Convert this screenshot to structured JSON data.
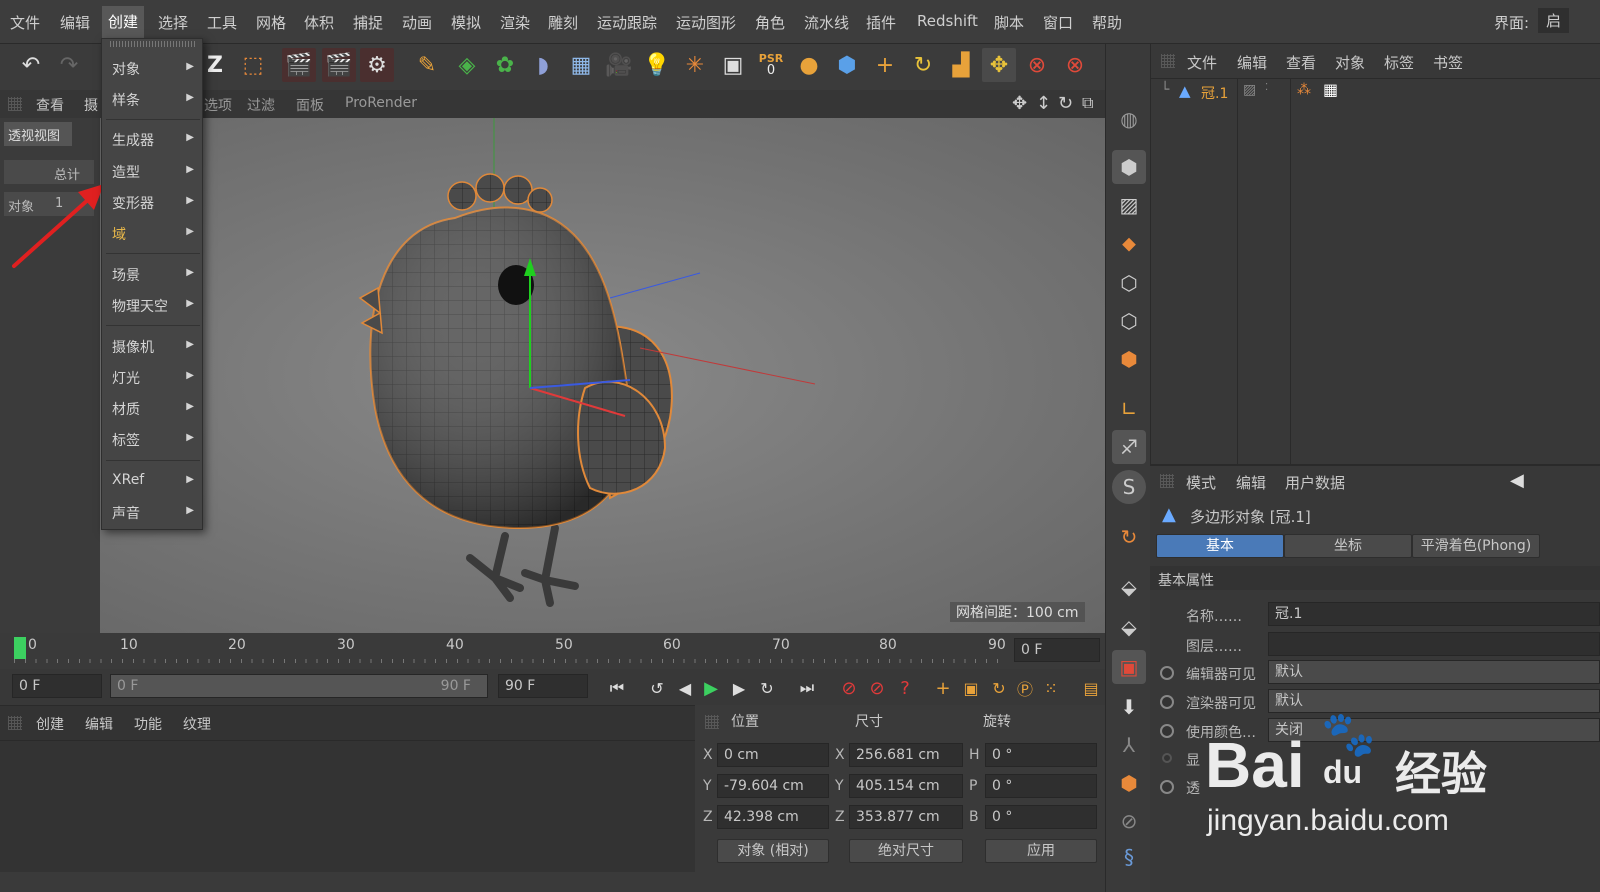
{
  "menubar": {
    "items": [
      "文件",
      "编辑",
      "创建",
      "选择",
      "工具",
      "网格",
      "体积",
      "捕捉",
      "动画",
      "模拟",
      "渲染",
      "雕刻",
      "运动跟踪",
      "运动图形",
      "角色",
      "流水线",
      "插件",
      "Redshift",
      "脚本",
      "窗口",
      "帮助"
    ],
    "layout_label": "界面:",
    "layout_value": "启"
  },
  "create_menu": {
    "items": [
      "对象",
      "样条",
      "生成器",
      "造型",
      "变形器",
      "域",
      "场景",
      "物理天空",
      "摄像机",
      "灯光",
      "材质",
      "标签",
      "XRef",
      "声音"
    ]
  },
  "viewport_bar": {
    "items": [
      "查看",
      "摄",
      "选项",
      "过滤",
      "面板",
      "ProRender"
    ]
  },
  "left_panel": {
    "title": "透视视图",
    "total_label": "总计",
    "object_label": "对象",
    "object_count": "1"
  },
  "viewport": {
    "grid_spacing": "网格间距：100 cm",
    "axis_y": "Y",
    "axis_z": "Z",
    "axis_x": "X"
  },
  "toolbar": {
    "psr_label": "PSR",
    "psr_value": "0"
  },
  "timeline": {
    "ticks": [
      "0",
      "10",
      "20",
      "30",
      "40",
      "50",
      "60",
      "70",
      "80",
      "90"
    ],
    "current_frame": "0 F"
  },
  "playbar": {
    "start": "0 F",
    "range_start": "0 F",
    "range_end": "90 F",
    "end": "90 F"
  },
  "material_manager": {
    "tabs": [
      "创建",
      "编辑",
      "功能",
      "纹理"
    ]
  },
  "coordinates": {
    "headers": [
      "位置",
      "尺寸",
      "旋转"
    ],
    "rows": [
      {
        "axis": "X",
        "pos": "0 cm",
        "size_axis": "X",
        "size": "256.681 cm",
        "rot_axis": "H",
        "rot": "0 °"
      },
      {
        "axis": "Y",
        "pos": "-79.604 cm",
        "size_axis": "Y",
        "size": "405.154 cm",
        "rot_axis": "P",
        "rot": "0 °"
      },
      {
        "axis": "Z",
        "pos": "42.398 cm",
        "size_axis": "Z",
        "size": "353.877 cm",
        "rot_axis": "B",
        "rot": "0 °"
      }
    ],
    "mode": "对象 (相对)",
    "size_mode": "绝对尺寸",
    "apply": "应用"
  },
  "object_manager": {
    "menu": [
      "文件",
      "编辑",
      "查看",
      "对象",
      "标签",
      "书签"
    ],
    "object_name": "冠.1"
  },
  "attribute_manager": {
    "menu": [
      "模式",
      "编辑",
      "用户数据"
    ],
    "object_title": "多边形对象 [冠.1]",
    "tabs": [
      "基本",
      "坐标",
      "平滑着色(Phong)"
    ],
    "section": "基本属性",
    "rows": [
      {
        "label": "名称……",
        "value": "冠.1"
      },
      {
        "label": "图层……",
        "value": ""
      },
      {
        "label": "编辑器可见",
        "value": "默认"
      },
      {
        "label": "渲染器可见",
        "value": "默认"
      },
      {
        "label": "使用颜色…",
        "value": "关闭"
      },
      {
        "label": "显",
        "value": ""
      },
      {
        "label": "透",
        "value": ""
      }
    ]
  },
  "watermark": {
    "brand": "Bai",
    "brand2": "du",
    "cn": "经验",
    "url": "jingyan.baidu.com"
  }
}
